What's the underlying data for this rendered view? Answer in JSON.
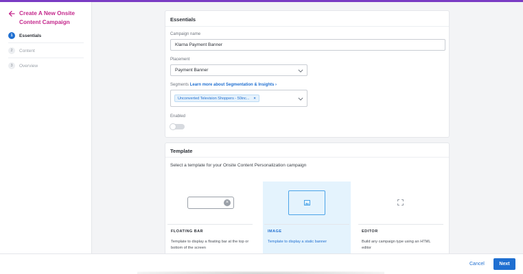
{
  "sidebar": {
    "title": "Create A New Onsite Content Campaign",
    "back_icon": "back-arrow-icon",
    "steps": [
      {
        "num": "1",
        "label": "Essentials",
        "active": true
      },
      {
        "num": "2",
        "label": "Content",
        "active": false
      },
      {
        "num": "3",
        "label": "Overview",
        "active": false
      }
    ]
  },
  "essentials": {
    "title": "Essentials",
    "campaign_name_label": "Campaign name",
    "campaign_name_value": "Klarna Payment Banner",
    "placement_label": "Placement",
    "placement_value": "Payment Banner",
    "segments_label": "Segments",
    "segments_link": "Learn more about Segmentation & Insights",
    "segments_link_icon": "chevron-right-icon",
    "segment_tag": "Unconverted Television Shoppers - 50inc...",
    "segment_tag_remove": "×",
    "enabled_label": "Enabled",
    "enabled": false
  },
  "template": {
    "title": "Template",
    "subtitle": "Select a template for your Onsite Content Personalization campaign",
    "options": [
      {
        "name": "FLOATING BAR",
        "desc": "Template to display a floating bar at the top or bottom of the screen",
        "icon": "floating-bar-icon",
        "selected": false
      },
      {
        "name": "IMAGE",
        "desc": "Template to display a static banner",
        "icon": "image-icon",
        "selected": true
      },
      {
        "name": "EDITOR",
        "desc": "Build any campaign type using an HTML editor",
        "icon": "expand-icon",
        "selected": false
      }
    ]
  },
  "footer": {
    "cancel_label": "Cancel",
    "next_label": "Next"
  },
  "colors": {
    "accent": "#1f6fd1",
    "brand_title": "#c4288c",
    "top_bar": "#7a3cc4",
    "selected_bg": "#e4f3fd"
  }
}
